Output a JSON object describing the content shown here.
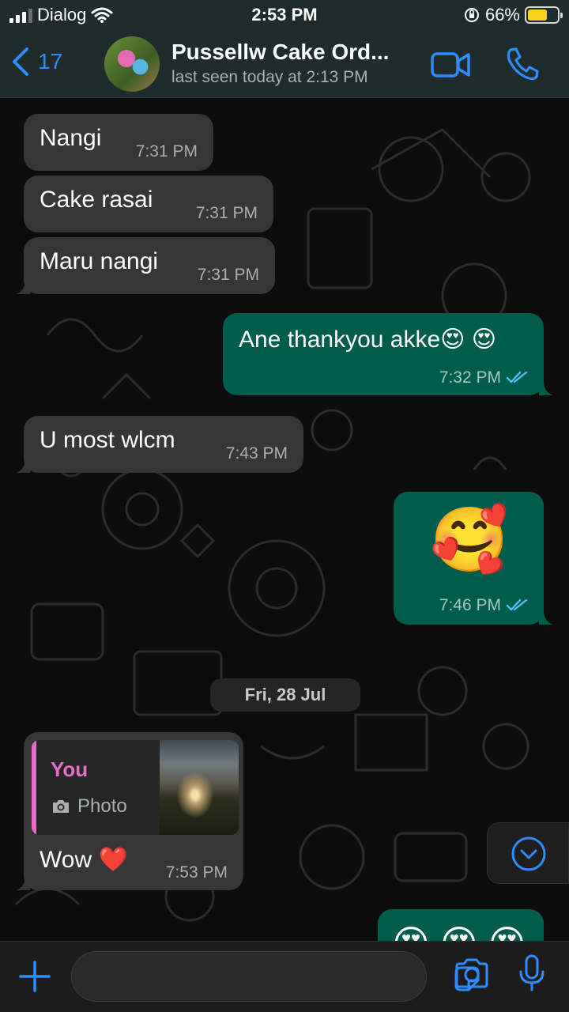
{
  "status_bar": {
    "carrier": "Dialog",
    "time": "2:53 PM",
    "battery_percent": "66%",
    "battery_level": 0.66
  },
  "header": {
    "back_count": "17",
    "contact_name": "Pussellw Cake Ord...",
    "last_seen": "last seen today at 2:13 PM"
  },
  "messages": [
    {
      "direction": "in",
      "text": "Nangi",
      "time": "7:31 PM"
    },
    {
      "direction": "in",
      "text": "Cake  rasai",
      "time": "7:31 PM"
    },
    {
      "direction": "in",
      "text": "Maru nangi",
      "time": "7:31 PM"
    },
    {
      "direction": "out",
      "text": "Ane thankyou akke😍 😍",
      "time": "7:32 PM",
      "status": "read"
    },
    {
      "direction": "in",
      "text": "U most  wlcm",
      "time": "7:43 PM"
    },
    {
      "direction": "out",
      "text": "🥰",
      "time": "7:46 PM",
      "status": "read"
    },
    {
      "direction": "in",
      "text": "Wow ❤️",
      "time": "7:53 PM",
      "reply": {
        "author": "You",
        "label": "Photo"
      }
    },
    {
      "direction": "out",
      "text": "😍 😍 😍",
      "time": ""
    }
  ],
  "date_separator": "Fri, 28 Jul",
  "input": {
    "placeholder": ""
  },
  "colors": {
    "accent": "#2f8cff",
    "incoming_bubble": "#363636",
    "outgoing_bubble": "#005c4b",
    "reply_author": "#e56fc5"
  },
  "icons": [
    "back-chevron-icon",
    "video-call-icon",
    "phone-call-icon",
    "read-ticks-icon",
    "camera-icon",
    "sticker-icon",
    "plus-icon",
    "microphone-icon",
    "scroll-down-icon",
    "wifi-icon",
    "signal-icon",
    "battery-icon",
    "orientation-lock-icon"
  ]
}
